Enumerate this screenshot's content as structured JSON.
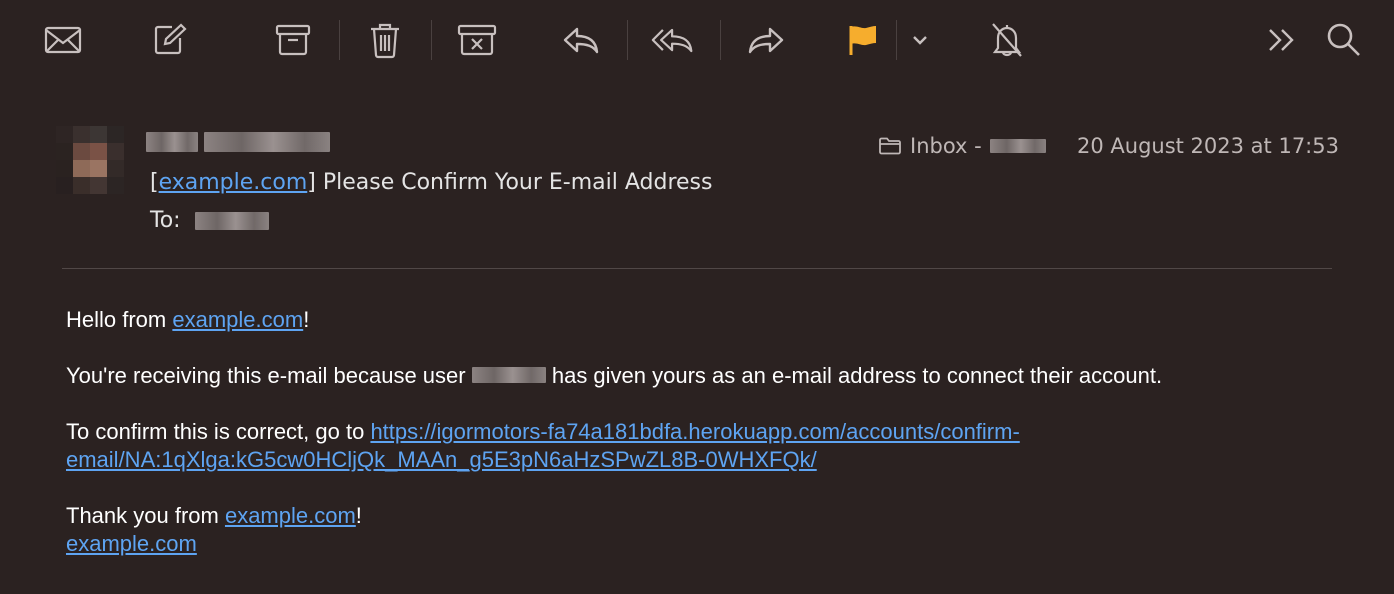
{
  "toolbar": {
    "buttons": [
      {
        "name": "get-mail-button",
        "icon": "envelope-icon"
      },
      {
        "name": "compose-button",
        "icon": "compose-icon"
      },
      {
        "name": "archive-button",
        "icon": "archive-box-icon"
      },
      {
        "name": "delete-button",
        "icon": "trash-icon"
      },
      {
        "name": "junk-button",
        "icon": "junk-box-icon"
      },
      {
        "name": "reply-button",
        "icon": "reply-icon"
      },
      {
        "name": "reply-all-button",
        "icon": "reply-all-icon"
      },
      {
        "name": "forward-button",
        "icon": "forward-icon"
      },
      {
        "name": "flag-button",
        "icon": "flag-icon"
      },
      {
        "name": "flag-menu-button",
        "icon": "chevron-down-icon"
      },
      {
        "name": "mute-button",
        "icon": "bell-slash-icon"
      },
      {
        "name": "more-button",
        "icon": "double-chevron-right-icon"
      },
      {
        "name": "search-button",
        "icon": "search-icon"
      }
    ],
    "flag_color": "#f6ad2d"
  },
  "message": {
    "mailbox_label": "Inbox -",
    "date": "20 August 2023 at 17:53",
    "subject_prefix_open": "[",
    "subject_link": "example.com",
    "subject_rest": "] Please Confirm Your E-mail Address",
    "to_label": "To:"
  },
  "body": {
    "greeting_text": "Hello from ",
    "greeting_link": "example.com",
    "greeting_end": "!",
    "receiving_before": "You're receiving this e-mail because user",
    "receiving_after": " has given yours as an e-mail address to connect their account.",
    "confirm_text": "To confirm this is correct, go to ",
    "confirm_link_line1": "https://igormotors-fa74a181bdfa.herokuapp.com/accounts/confirm-",
    "confirm_link_line2": "email/NA:1qXlga:kG5cw0HCljQk_MAAn_g5E3pN6aHzSPwZL8B-0WHXFQk/",
    "thanks_text": "Thank you from ",
    "thanks_link": "example.com",
    "thanks_end": "!",
    "signature_link": "example.com"
  },
  "colors": {
    "background": "#2b2221",
    "link": "#5ea4f2",
    "icon": "#c8c0bf"
  }
}
